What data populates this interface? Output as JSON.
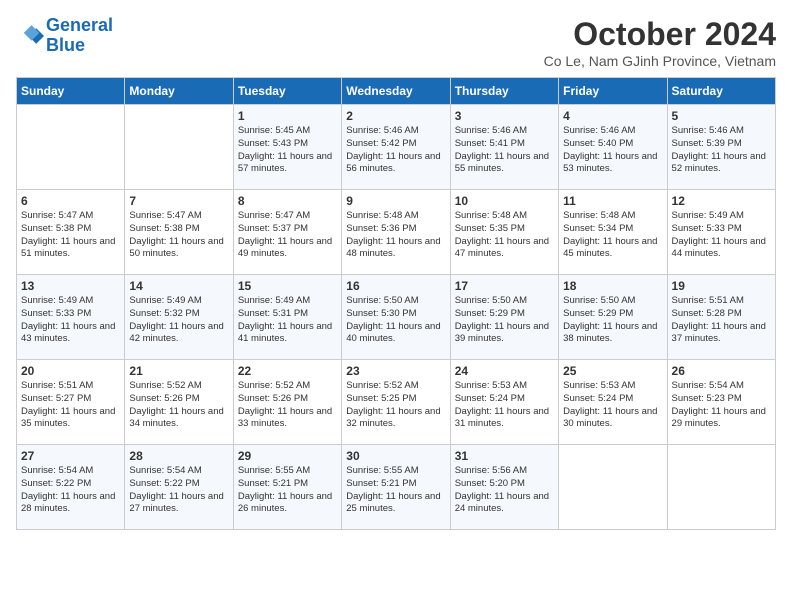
{
  "header": {
    "logo_line1": "General",
    "logo_line2": "Blue",
    "month": "October 2024",
    "location": "Co Le, Nam GJinh Province, Vietnam"
  },
  "weekdays": [
    "Sunday",
    "Monday",
    "Tuesday",
    "Wednesday",
    "Thursday",
    "Friday",
    "Saturday"
  ],
  "weeks": [
    [
      {
        "day": "",
        "text": ""
      },
      {
        "day": "",
        "text": ""
      },
      {
        "day": "1",
        "text": "Sunrise: 5:45 AM\nSunset: 5:43 PM\nDaylight: 11 hours\nand 57 minutes."
      },
      {
        "day": "2",
        "text": "Sunrise: 5:46 AM\nSunset: 5:42 PM\nDaylight: 11 hours\nand 56 minutes."
      },
      {
        "day": "3",
        "text": "Sunrise: 5:46 AM\nSunset: 5:41 PM\nDaylight: 11 hours\nand 55 minutes."
      },
      {
        "day": "4",
        "text": "Sunrise: 5:46 AM\nSunset: 5:40 PM\nDaylight: 11 hours\nand 53 minutes."
      },
      {
        "day": "5",
        "text": "Sunrise: 5:46 AM\nSunset: 5:39 PM\nDaylight: 11 hours\nand 52 minutes."
      }
    ],
    [
      {
        "day": "6",
        "text": "Sunrise: 5:47 AM\nSunset: 5:38 PM\nDaylight: 11 hours\nand 51 minutes."
      },
      {
        "day": "7",
        "text": "Sunrise: 5:47 AM\nSunset: 5:38 PM\nDaylight: 11 hours\nand 50 minutes."
      },
      {
        "day": "8",
        "text": "Sunrise: 5:47 AM\nSunset: 5:37 PM\nDaylight: 11 hours\nand 49 minutes."
      },
      {
        "day": "9",
        "text": "Sunrise: 5:48 AM\nSunset: 5:36 PM\nDaylight: 11 hours\nand 48 minutes."
      },
      {
        "day": "10",
        "text": "Sunrise: 5:48 AM\nSunset: 5:35 PM\nDaylight: 11 hours\nand 47 minutes."
      },
      {
        "day": "11",
        "text": "Sunrise: 5:48 AM\nSunset: 5:34 PM\nDaylight: 11 hours\nand 45 minutes."
      },
      {
        "day": "12",
        "text": "Sunrise: 5:49 AM\nSunset: 5:33 PM\nDaylight: 11 hours\nand 44 minutes."
      }
    ],
    [
      {
        "day": "13",
        "text": "Sunrise: 5:49 AM\nSunset: 5:33 PM\nDaylight: 11 hours\nand 43 minutes."
      },
      {
        "day": "14",
        "text": "Sunrise: 5:49 AM\nSunset: 5:32 PM\nDaylight: 11 hours\nand 42 minutes."
      },
      {
        "day": "15",
        "text": "Sunrise: 5:49 AM\nSunset: 5:31 PM\nDaylight: 11 hours\nand 41 minutes."
      },
      {
        "day": "16",
        "text": "Sunrise: 5:50 AM\nSunset: 5:30 PM\nDaylight: 11 hours\nand 40 minutes."
      },
      {
        "day": "17",
        "text": "Sunrise: 5:50 AM\nSunset: 5:29 PM\nDaylight: 11 hours\nand 39 minutes."
      },
      {
        "day": "18",
        "text": "Sunrise: 5:50 AM\nSunset: 5:29 PM\nDaylight: 11 hours\nand 38 minutes."
      },
      {
        "day": "19",
        "text": "Sunrise: 5:51 AM\nSunset: 5:28 PM\nDaylight: 11 hours\nand 37 minutes."
      }
    ],
    [
      {
        "day": "20",
        "text": "Sunrise: 5:51 AM\nSunset: 5:27 PM\nDaylight: 11 hours\nand 35 minutes."
      },
      {
        "day": "21",
        "text": "Sunrise: 5:52 AM\nSunset: 5:26 PM\nDaylight: 11 hours\nand 34 minutes."
      },
      {
        "day": "22",
        "text": "Sunrise: 5:52 AM\nSunset: 5:26 PM\nDaylight: 11 hours\nand 33 minutes."
      },
      {
        "day": "23",
        "text": "Sunrise: 5:52 AM\nSunset: 5:25 PM\nDaylight: 11 hours\nand 32 minutes."
      },
      {
        "day": "24",
        "text": "Sunrise: 5:53 AM\nSunset: 5:24 PM\nDaylight: 11 hours\nand 31 minutes."
      },
      {
        "day": "25",
        "text": "Sunrise: 5:53 AM\nSunset: 5:24 PM\nDaylight: 11 hours\nand 30 minutes."
      },
      {
        "day": "26",
        "text": "Sunrise: 5:54 AM\nSunset: 5:23 PM\nDaylight: 11 hours\nand 29 minutes."
      }
    ],
    [
      {
        "day": "27",
        "text": "Sunrise: 5:54 AM\nSunset: 5:22 PM\nDaylight: 11 hours\nand 28 minutes."
      },
      {
        "day": "28",
        "text": "Sunrise: 5:54 AM\nSunset: 5:22 PM\nDaylight: 11 hours\nand 27 minutes."
      },
      {
        "day": "29",
        "text": "Sunrise: 5:55 AM\nSunset: 5:21 PM\nDaylight: 11 hours\nand 26 minutes."
      },
      {
        "day": "30",
        "text": "Sunrise: 5:55 AM\nSunset: 5:21 PM\nDaylight: 11 hours\nand 25 minutes."
      },
      {
        "day": "31",
        "text": "Sunrise: 5:56 AM\nSunset: 5:20 PM\nDaylight: 11 hours\nand 24 minutes."
      },
      {
        "day": "",
        "text": ""
      },
      {
        "day": "",
        "text": ""
      }
    ]
  ]
}
